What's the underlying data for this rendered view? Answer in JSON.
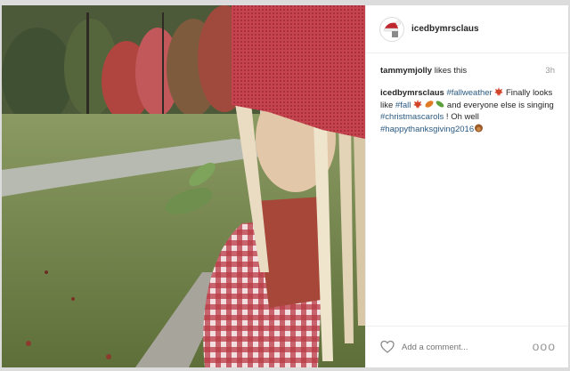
{
  "post": {
    "username": "icedbymrsclaus",
    "avatar_icon": "santa-hat-logo-icon",
    "likes": {
      "user": "tammymjolly",
      "suffix": " likes this"
    },
    "time_ago": "3h",
    "caption": {
      "user": "icedbymrsclaus",
      "tag_fallweather": "#fallweather",
      "text1": " Finally looks like ",
      "tag_fall": "#fall",
      "text2": " and everyone else is singing ",
      "tag_carols": "#christmascarols",
      "text3": " ! Oh well ",
      "tag_thanks": "#happythanksgiving2016"
    },
    "comment_placeholder": "Add a comment...",
    "more_label": "ooo",
    "photo_alt": "scarecrow-in-fall-yard",
    "colors": {
      "accent_link": "#2b5a83",
      "text": "#262626",
      "muted": "#999999"
    }
  }
}
